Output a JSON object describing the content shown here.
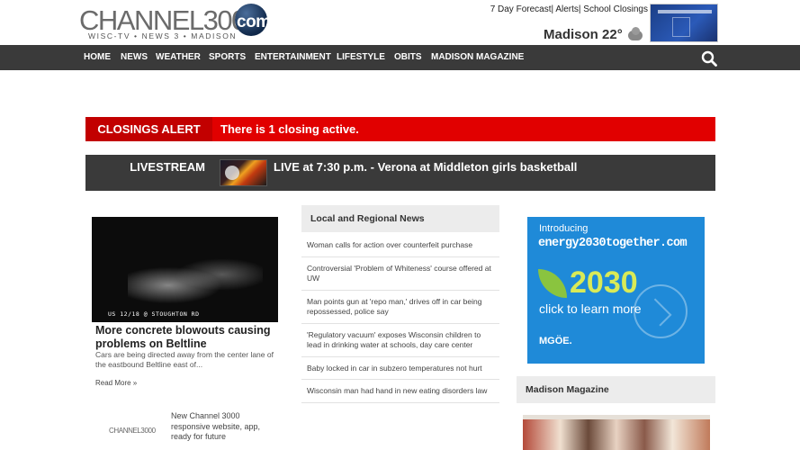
{
  "header": {
    "logo_word": "CHANNEL3000",
    "logo_com": "com",
    "logo_sub": "WISC-TV • NEWS 3 • MADISON",
    "top_links": [
      "7 Day Forecast|",
      "Alerts|",
      "School Closings"
    ],
    "weather_city": "Madison",
    "weather_temp": "22°"
  },
  "nav": {
    "items": [
      "HOME",
      "NEWS",
      "WEATHER",
      "SPORTS",
      "ENTERTAINMENT",
      "LIFESTYLE",
      "OBITS",
      "MADISON MAGAZINE"
    ]
  },
  "alert": {
    "label": "CLOSINGS ALERT",
    "text": "There is 1 closing active."
  },
  "livestream": {
    "label": "LIVESTREAM",
    "text": "LIVE at 7:30 p.m. - Verona at Middleton girls basketball"
  },
  "top_story": {
    "image_caption": "US 12/18 @ STOUGHTON RD",
    "title": "More concrete blowouts causing problems on Beltline",
    "summary": "Cars are being directed away from the center lane of the eastbound Beltline east of...",
    "read_more": "Read More »"
  },
  "promo": {
    "logo": "CHANNEL3000",
    "text": "New Channel 3000 responsive website, app, ready for future"
  },
  "news": {
    "header": "Local and Regional News",
    "items": [
      "Woman calls for action over counterfeit purchase",
      "Controversial 'Problem of Whiteness' course offered at UW",
      "Man points gun at 'repo man,' drives off in car being repossessed, police say",
      "'Regulatory vacuum' exposes Wisconsin children to lead in drinking water at schools, day care center",
      "Baby locked in car in subzero temperatures not hurt",
      "Wisconsin man had hand in new eating disorders law"
    ]
  },
  "ad": {
    "intro": "Introducing",
    "url": "energy2030together.com",
    "year": "2030",
    "cta": "click to learn more",
    "brand": "MGÖE."
  },
  "magazine": {
    "header": "Madison Magazine"
  }
}
